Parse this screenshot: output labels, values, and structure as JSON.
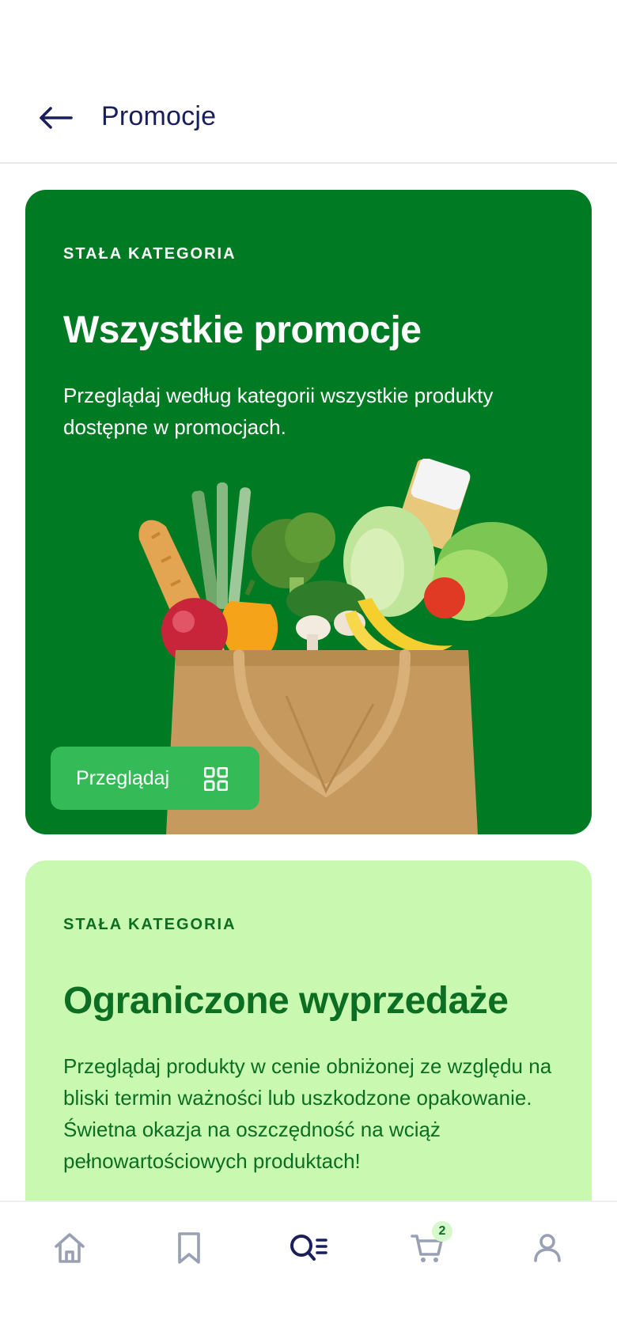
{
  "header": {
    "title": "Promocje",
    "back_icon": "arrow-left-icon"
  },
  "cards": [
    {
      "eyebrow": "STAŁA KATEGORIA",
      "title": "Wszystkie promocje",
      "description": "Przeglądaj według kategorii wszystkie produkty dostępne w promocjach.",
      "button_label": "Przeglądaj",
      "button_icon": "grid-icon",
      "background": "#007a23",
      "button_color": "#34bb57"
    },
    {
      "eyebrow": "STAŁA KATEGORIA",
      "title": "Ograniczone wyprzedaże",
      "description": "Przeglądaj produkty w cenie obniżonej ze względu na bliski termin ważności lub uszkodzone opakowanie. Świetna okazja na oszczędność na wciąż pełnowartościowych produktach!",
      "background": "#c9f9b0",
      "text_color": "#0c6e22"
    }
  ],
  "bottom_nav": {
    "items": [
      {
        "icon": "home-icon"
      },
      {
        "icon": "bookmark-icon"
      },
      {
        "icon": "search-list-icon",
        "active": true
      },
      {
        "icon": "cart-icon",
        "badge": "2"
      },
      {
        "icon": "profile-icon"
      }
    ]
  },
  "colors": {
    "primary_dark": "#1a1f5c",
    "nav_inactive": "#9aa0b4"
  }
}
